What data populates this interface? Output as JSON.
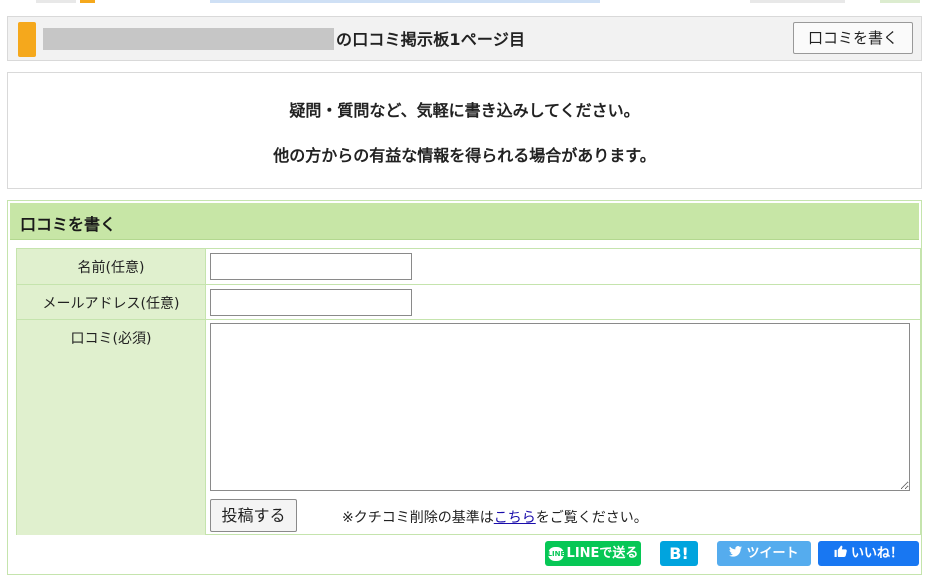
{
  "title": {
    "suffix": "の口コミ掲示板1ページ目",
    "write_button": "口コミを書く"
  },
  "intro": {
    "line1": "疑問・質問など、気軽に書き込みしてください。",
    "line2": "他の方からの有益な情報を得られる場合があります。"
  },
  "form": {
    "header": "口コミを書く",
    "name_label": "名前(任意)",
    "email_label": "メールアドレス(任意)",
    "comment_label": "口コミ(必須)",
    "name_value": "",
    "email_value": "",
    "comment_value": "",
    "submit_label": "投稿する",
    "note_prefix": "※クチコミ削除の基準は",
    "note_link": "こちら",
    "note_suffix": "をご覧ください。"
  },
  "share": {
    "line": "LINEで送る",
    "line_icon_text": "LINE",
    "hatena": "B!",
    "tweet": "ツイート",
    "like": "いいね！"
  },
  "colors": {
    "accent_orange": "#f5a81c",
    "form_header_green": "#c7e6a6",
    "label_green": "#e0f0ce",
    "line_green": "#06c755",
    "hatena_blue": "#00a4de",
    "twitter_blue": "#55acee",
    "facebook_blue": "#1877f2"
  },
  "icons": [
    "line-icon",
    "twitter-bird-icon",
    "thumbs-up-icon"
  ]
}
